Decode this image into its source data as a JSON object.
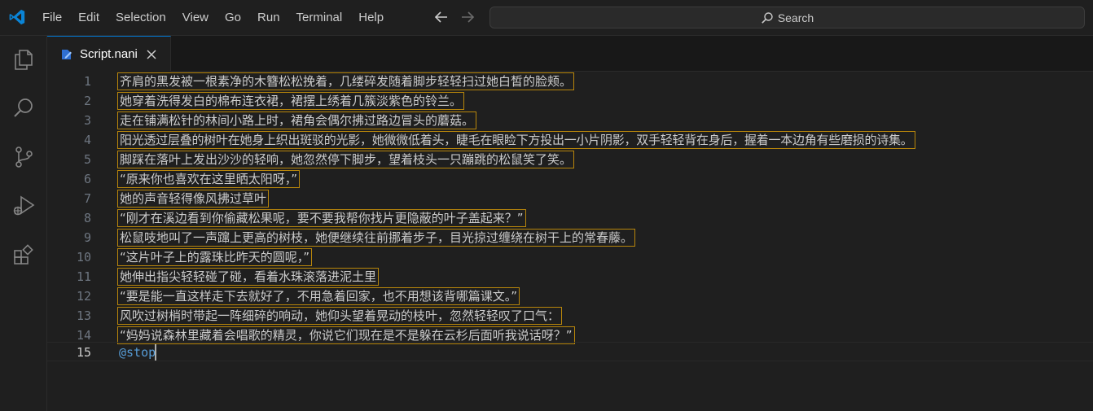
{
  "menu": [
    "File",
    "Edit",
    "Selection",
    "View",
    "Go",
    "Run",
    "Terminal",
    "Help"
  ],
  "search": {
    "label": "Search"
  },
  "tab": {
    "label": "Script.nani"
  },
  "activity_icons": [
    "explorer-icon",
    "search-icon",
    "source-control-icon",
    "run-debug-icon",
    "extensions-icon"
  ],
  "editor": {
    "lines": [
      {
        "number": "1",
        "text": "齐肩的黑发被一根素净的木簪松松挽着，几缕碎发随着脚步轻轻扫过她白皙的脸颊。"
      },
      {
        "number": "2",
        "text": "她穿着洗得发白的棉布连衣裙，裙摆上绣着几簇淡紫色的铃兰。"
      },
      {
        "number": "3",
        "text": "走在铺满松针的林间小路上时，裙角会偶尔拂过路边冒头的蘑菇。"
      },
      {
        "number": "4",
        "text": "阳光透过层叠的树叶在她身上织出斑驳的光影，她微微低着头，睫毛在眼睑下方投出一小片阴影，双手轻轻背在身后，握着一本边角有些磨损的诗集。"
      },
      {
        "number": "5",
        "text": "脚踩在落叶上发出沙沙的轻响，她忽然停下脚步，望着枝头一只蹦跳的松鼠笑了笑。"
      },
      {
        "number": "6",
        "text": "“原来你也喜欢在这里晒太阳呀，”"
      },
      {
        "number": "7",
        "text": "她的声音轻得像风拂过草叶"
      },
      {
        "number": "8",
        "text": "“刚才在溪边看到你偷藏松果呢，要不要我帮你找片更隐蔽的叶子盖起来？”"
      },
      {
        "number": "9",
        "text": "松鼠吱地叫了一声蹿上更高的树枝，她便继续往前挪着步子，目光掠过缠绕在树干上的常春藤。"
      },
      {
        "number": "10",
        "text": "“这片叶子上的露珠比昨天的圆呢，”"
      },
      {
        "number": "11",
        "text": "她伸出指尖轻轻碰了碰，看着水珠滚落进泥土里"
      },
      {
        "number": "12",
        "text": "“要是能一直这样走下去就好了，不用急着回家，也不用想该背哪篇课文。”"
      },
      {
        "number": "13",
        "text": "风吹过树梢时带起一阵细碎的响动，她仰头望着晃动的枝叶，忽然轻轻叹了口气："
      },
      {
        "number": "14",
        "text": "“妈妈说森林里藏着会唱歌的精灵，你说它们现在是不是躲在云杉后面听我说话呀？”"
      },
      {
        "number": "15",
        "text": "@stop"
      }
    ]
  }
}
